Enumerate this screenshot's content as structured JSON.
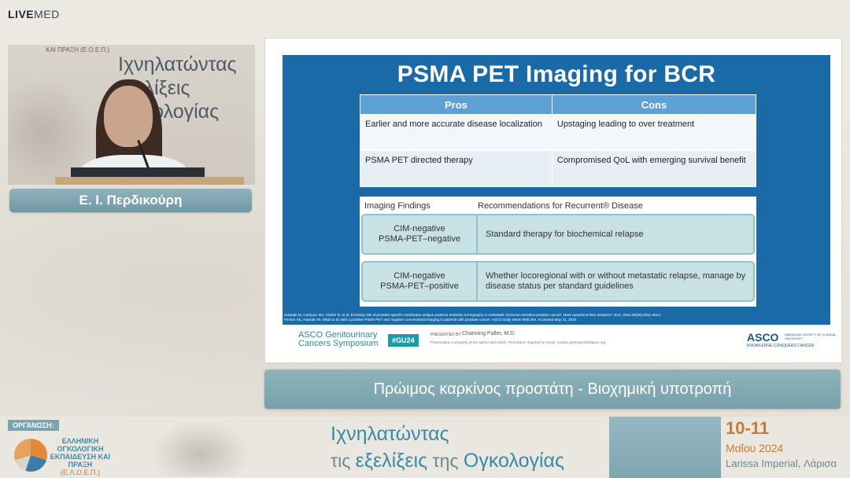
{
  "header": {
    "logo_bold": "LIVE",
    "logo_rest": "MED"
  },
  "speaker": {
    "name": "Ε. Ι. Περδικούρη",
    "video_banner_text": "Ιχνηλατώντας εξελίξεις Ογκολογίας",
    "video_org_text": "ΚΑΙ ΠΡΑΞΗ (Ε.Ο.Ε.Π.)"
  },
  "slide": {
    "title": "PSMA PET Imaging for BCR",
    "table_headers": [
      "Pros",
      "Cons"
    ],
    "table_rows": [
      [
        "Earlier and more accurate disease localization",
        "Upstaging leading to over treatment"
      ],
      [
        "PSMA PET directed therapy",
        "Compromised QoL with emerging survival benefit"
      ]
    ],
    "recommendations": {
      "header_left": "Imaging Findings",
      "header_right": "Recommendations for Recurrent® Disease",
      "rows": [
        {
          "finding": "CIM-negative\nPSMA-PET–negative",
          "recommendation": "Standard therapy for biochemical relapse"
        },
        {
          "finding": "CIM-negative\nPSMA-PET–positive",
          "recommendation": "Whether locoregional with or without metastatic relapse, manage by disease status per standard guidelines"
        }
      ]
    },
    "references": [
      "Hussain M, Carducci MA, Clarke N, et al. Evolving role of prostate-specific membrane antigen-positron emission tomography in metastatic hormone-sensitive prostate cancer: More questions than answers? JCO. 2022;40(26):3011-3014.",
      "Fenton SE, Hussain M. What to do with a positive PSMA PET and negative conventional imaging in patients with prostate cancer. ASCO Daily News Web site. Accessed May 31, 2023."
    ],
    "footer": {
      "asco_gu": "ASCO Genitourinary\nCancers Symposium",
      "hashtag": "#GU24",
      "presented_by": "PRESENTED BY:",
      "presenter": "Channing Paller, M.D.",
      "note": "Presentation is property of the author and ASCO. Permission required for reuse; contact permissions@asco.org",
      "asco_logo": "ASCO",
      "asco_sub": "AMERICAN SOCIETY OF CLINICAL ONCOLOGY",
      "asco_tagline": "KNOWLEDGE CONQUERS CANCER"
    }
  },
  "caption": "Πρώιμος καρκίνος προστάτη - Βιοχημική υποτροπή",
  "banner": {
    "org_label": "ΟΡΓΑΝΩΣΗ:",
    "org_name": "ΕΛΛΗΝΙΚΗ ΟΓΚΟΛΟΓΙΚΗ ΕΚΠΑΙΔΕΥΣΗ ΚΑΙ ΠΡΑΞΗ",
    "org_abbr": "(Ε.Λ.Ο.Ε.Π.)",
    "title_line1": "Ιχνηλατώντας",
    "title_line2_a": "τις ",
    "title_line2_b": "εξελίξεις",
    "title_line2_c": " της ",
    "title_line2_d": "Ογκολογίας",
    "dates": "10-11",
    "month_year": "Μαΐου 2024",
    "place": "Larissa Imperial, Λάρισα"
  }
}
